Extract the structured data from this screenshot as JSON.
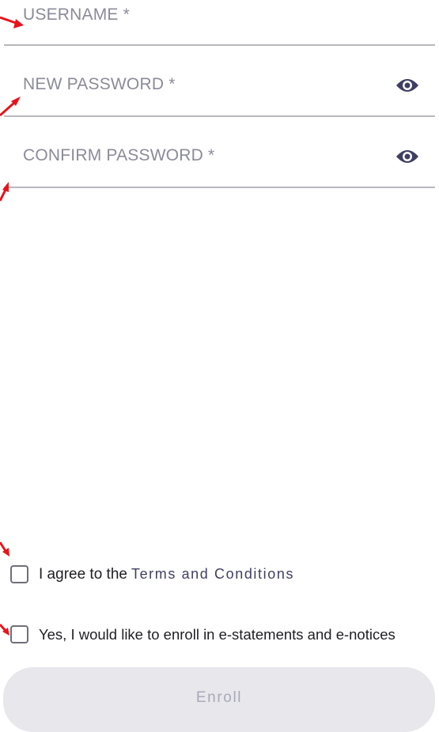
{
  "form": {
    "fields": [
      {
        "label": "USERNAME *",
        "has_toggle": false
      },
      {
        "label": "NEW PASSWORD *",
        "has_toggle": true,
        "toggle_icon": "eye-icon"
      },
      {
        "label": "CONFIRM PASSWORD *",
        "has_toggle": true,
        "toggle_icon": "eye-icon"
      }
    ],
    "terms": {
      "prefix": "I agree to the",
      "link": "Terms and Conditions",
      "checked": false
    },
    "estatements": {
      "label": "Yes, I would like to enroll in e-statements and e-notices",
      "checked": false
    },
    "enroll_button": {
      "label": "Enroll",
      "enabled": false
    }
  },
  "colors": {
    "label": "#8b8b99",
    "underline": "#b8b8bd",
    "icon": "#3f3f63",
    "link": "#3f3f63",
    "button_bg_disabled": "#e7e7ec",
    "button_text_disabled": "#a9a9b8",
    "annotation_arrow": "#e8141b"
  },
  "annotations": {
    "arrow_icon": "red-pointer-arrow-icon",
    "count": 5
  }
}
